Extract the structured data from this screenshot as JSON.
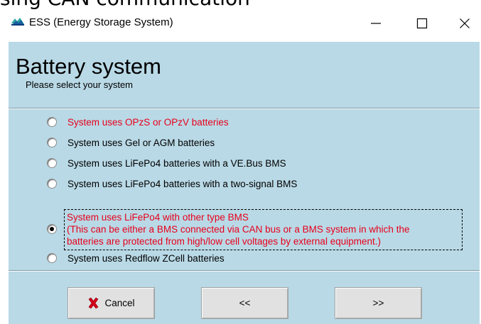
{
  "background_caption": "sing CAN communication",
  "window": {
    "title": "ESS (Energy Storage System)",
    "controls": {
      "minimize": "—",
      "maximize": "☐",
      "close": "✕"
    }
  },
  "page": {
    "heading": "Battery system",
    "subheading": "Please select your system"
  },
  "options": [
    {
      "label": "System uses OPzS or OPzV batteries",
      "checked": false,
      "color": "#e8001c"
    },
    {
      "label": "System uses Gel or AGM batteries",
      "checked": false,
      "color": "#000000"
    },
    {
      "label": "System uses LiFePo4 batteries with a VE.Bus BMS",
      "checked": false,
      "color": "#000000"
    },
    {
      "label": "System uses LiFePo4 batteries with a two-signal BMS",
      "checked": false,
      "color": "#000000"
    },
    {
      "label_lines": [
        "System uses LiFePo4 with other type BMS",
        "(This can be either a BMS connected via CAN bus or a BMS system in which the",
        "batteries are protected from high/low cell voltages by external equipment.)"
      ],
      "checked": true,
      "color": "#e8001c"
    },
    {
      "label": "System uses Redflow ZCell batteries",
      "checked": false,
      "color": "#000000"
    }
  ],
  "buttons": {
    "cancel": "Cancel",
    "back": "<<",
    "next": ">>"
  },
  "colors": {
    "client_background": "#b9d9e6",
    "accent_red": "#e8001c",
    "button_face": "#e1e1e1"
  }
}
